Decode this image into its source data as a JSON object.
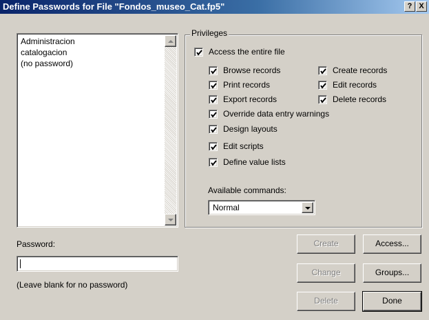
{
  "window": {
    "title": "Define Passwords for File \"Fondos_museo_Cat.fp5\"",
    "help_glyph": "?",
    "close_glyph": "X"
  },
  "accounts": {
    "items": [
      "Administracion",
      "catalogacion",
      "(no password)"
    ]
  },
  "privileges": {
    "legend": "Privileges",
    "access_entire_file": {
      "label": "Access the entire file",
      "checked": true
    },
    "left_column": [
      {
        "label": "Browse records",
        "checked": true
      },
      {
        "label": "Print records",
        "checked": true
      },
      {
        "label": "Export records",
        "checked": true
      },
      {
        "label": "Override data entry warnings",
        "checked": true
      },
      {
        "label": "Design layouts",
        "checked": true
      },
      {
        "label": "Edit scripts",
        "checked": true
      },
      {
        "label": "Define value lists",
        "checked": true
      }
    ],
    "right_column": [
      {
        "label": "Create records",
        "checked": true
      },
      {
        "label": "Edit records",
        "checked": true
      },
      {
        "label": "Delete records",
        "checked": true
      }
    ],
    "available_commands_label": "Available commands:",
    "available_commands_value": "Normal"
  },
  "password": {
    "label": "Password:",
    "value": "",
    "hint": "(Leave blank for no password)"
  },
  "buttons": {
    "create": "Create",
    "change": "Change",
    "delete": "Delete",
    "access": "Access...",
    "groups": "Groups...",
    "done": "Done"
  }
}
